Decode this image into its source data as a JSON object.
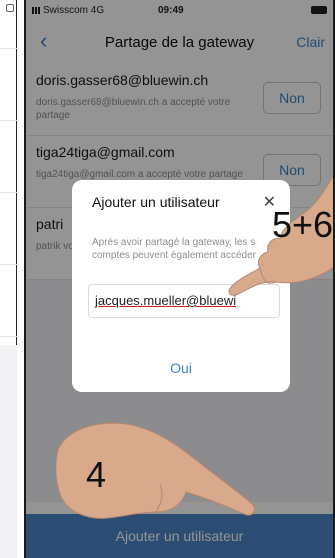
{
  "status_bar": {
    "carrier": "Swisscom  4G",
    "time": "09:49"
  },
  "nav": {
    "back_icon": "chevron-left-icon",
    "title": "Partage de la gateway",
    "action": "Clair"
  },
  "shares": [
    {
      "email": "doris.gasser68@bluewin.ch",
      "status": "doris.gasser68@bluewin.ch a accepté votre partage",
      "button": "Non"
    },
    {
      "email": "tiga24tiga@gmail.com",
      "status": "tiga24tiga@gmail.com a accepté votre partage",
      "button": "Non"
    },
    {
      "email": "patri",
      "status": "patrik votre",
      "button": ""
    }
  ],
  "dialog": {
    "title": "Ajouter un utilisateur",
    "close_icon": "close-icon",
    "description": "Après avoir partagé la gateway, les s comptes peuvent également accéder",
    "input_value": "jacques.mueller@bluewi",
    "confirm": "Oui"
  },
  "bottom_button": "Ajouter un utilisateur",
  "annotations": {
    "step_top": "5+6",
    "step_bottom": "4"
  },
  "colors": {
    "accent": "#3c84c8",
    "bottom_bar": "#4a85c9",
    "overlay": "rgba(0,0,0,0.42)"
  }
}
